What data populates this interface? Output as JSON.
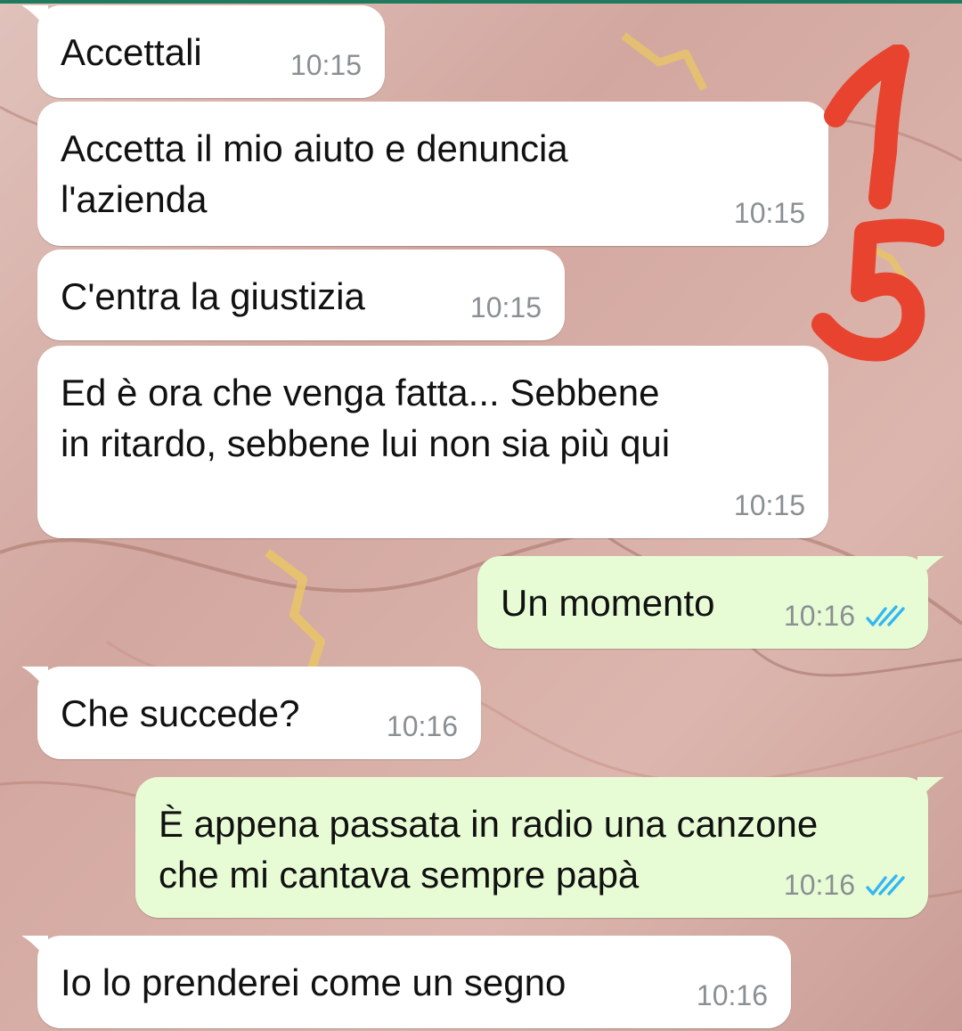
{
  "colors": {
    "incoming_bubble": "#ffffff",
    "outgoing_bubble": "#e7fcd5",
    "timestamp": "#8a8f93",
    "read_ticks": "#34b7f1",
    "annotation": "#e8432e"
  },
  "messages": [
    {
      "direction": "incoming",
      "text": "Accettali",
      "time": "10:15"
    },
    {
      "direction": "incoming",
      "text": "Accetta il mio aiuto e denuncia\nl'azienda",
      "time": "10:15"
    },
    {
      "direction": "incoming",
      "text": "C'entra la giustizia",
      "time": "10:15"
    },
    {
      "direction": "incoming",
      "text": "Ed è ora che venga fatta... Sebbene\nin ritardo, sebbene lui non sia più qui",
      "time": "10:15"
    },
    {
      "direction": "outgoing",
      "text": "Un momento",
      "time": "10:16",
      "status_icon": "double-check-read-icon"
    },
    {
      "direction": "incoming",
      "text": "Che succede?",
      "time": "10:16"
    },
    {
      "direction": "outgoing",
      "text": "È appena passata in radio una canzone\nche mi cantava sempre papà",
      "time": "10:16",
      "status_icon": "double-check-read-icon"
    },
    {
      "direction": "incoming",
      "text": "Io lo prenderei come un segno",
      "time": "10:16"
    }
  ],
  "annotation": {
    "digits": [
      "1",
      "5"
    ]
  }
}
